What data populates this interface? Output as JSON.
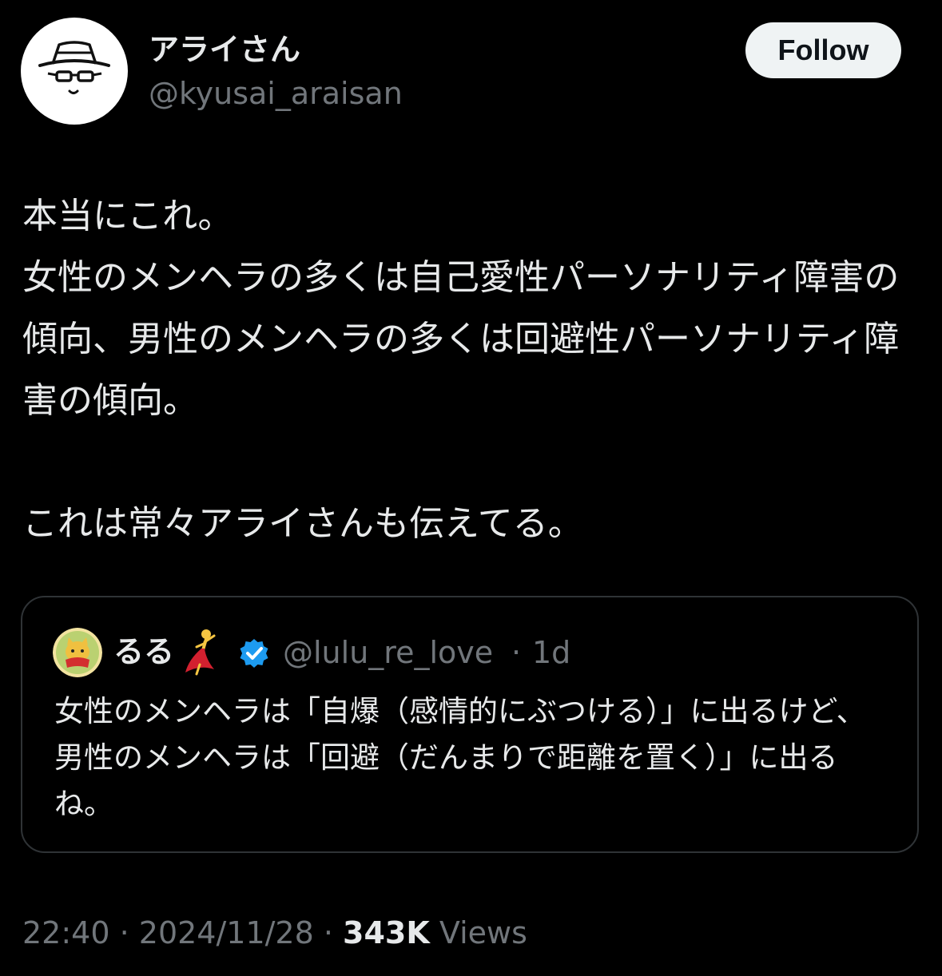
{
  "author": {
    "display_name": "アライさん",
    "handle": "@kyusai_araisan",
    "avatar_icon": "hat-glasses-face-icon"
  },
  "follow_label": "Follow",
  "tweet": {
    "text": "本当にこれ。\n女性のメンヘラの多くは自己愛性パーソナリティ障害の傾向、男性のメンヘラの多くは回避性パーソナリティ障害の傾向。\n\nこれは常々アライさんも伝えてる。"
  },
  "quote": {
    "display_name": "るる",
    "name_emoji_icon": "dancer-icon",
    "verified_icon": "verified-badge-icon",
    "handle": "@lulu_re_love",
    "separator": "·",
    "time": "1d",
    "text": "女性のメンヘラは「自爆（感情的にぶつける）」に出るけど、男性のメンヘラは「回避（だんまりで距離を置く）」に出るね。"
  },
  "meta": {
    "time": "22:40",
    "sep1": " · ",
    "date": "2024/11/28",
    "sep2": " · ",
    "views_count": "343K",
    "views_label": " Views"
  },
  "colors": {
    "background": "#000000",
    "text_primary": "#e7e9ea",
    "text_secondary": "#71767b",
    "verified": "#1d9bf0",
    "border": "#2f3336"
  }
}
